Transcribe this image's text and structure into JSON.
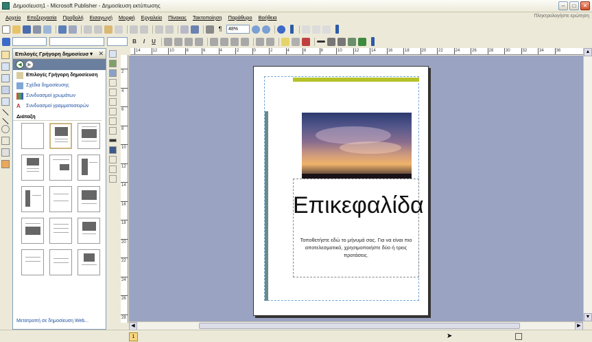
{
  "window": {
    "title": "Δημοσίευση1 - Microsoft Publisher - Δημοσίευση εκτύπωσης",
    "help_placeholder": "Πληκτρολογήστε ερώτηση"
  },
  "menu": [
    "Αρχείο",
    "Επεξεργασία",
    "Προβολή",
    "Εισαγωγή",
    "Μορφή",
    "Εργαλεία",
    "Πίνακας",
    "Τακτοποίηση",
    "Παράθυρο",
    "Βοήθεια"
  ],
  "toolbar": {
    "zoom": "48%"
  },
  "taskpane": {
    "title": "Επιλογές Γρήγορη δημοσίευσ▼",
    "links": [
      {
        "label": "Επιλογές Γρήγορη δημοσίευση",
        "icon": "publication-options-icon",
        "bold": true
      },
      {
        "label": "Σχέδια δημοσίευσης",
        "icon": "design-icon",
        "bold": false
      },
      {
        "label": "Συνδυασμοί χρωμάτων",
        "icon": "color-scheme-icon",
        "bold": false
      },
      {
        "label": "Συνδυασμοί γραμματοσειρών",
        "icon": "font-scheme-icon",
        "bold": false
      }
    ],
    "layout_label": "Διάταξη",
    "bottom_link": "Μετατροπή σε δημοσίευση Web..."
  },
  "ruler": {
    "h_labels": [
      "14",
      "12",
      "10",
      "8",
      "6",
      "4",
      "2",
      "0",
      "2",
      "4",
      "6",
      "8",
      "10",
      "12",
      "14",
      "16",
      "18",
      "20",
      "22",
      "24",
      "26",
      "28",
      "30",
      "32",
      "34",
      "36"
    ],
    "v_labels": [
      "2",
      "4",
      "6",
      "8",
      "10",
      "12",
      "14",
      "16",
      "18",
      "20",
      "22",
      "24",
      "26",
      "28"
    ]
  },
  "document": {
    "headline": "Επικεφαλίδα",
    "body": "Τοποθετήστε εδώ το μήνυμά σας. Για να είναι πιο αποτελεσματικό, χρησιμοποιήστε δύο ή τρεις προτάσεις."
  },
  "status": {
    "page": "1"
  },
  "colors": {
    "accent_bar": "#b5c229",
    "side_bar": "#6b8a8a",
    "workspace": "#9ba3c2"
  }
}
